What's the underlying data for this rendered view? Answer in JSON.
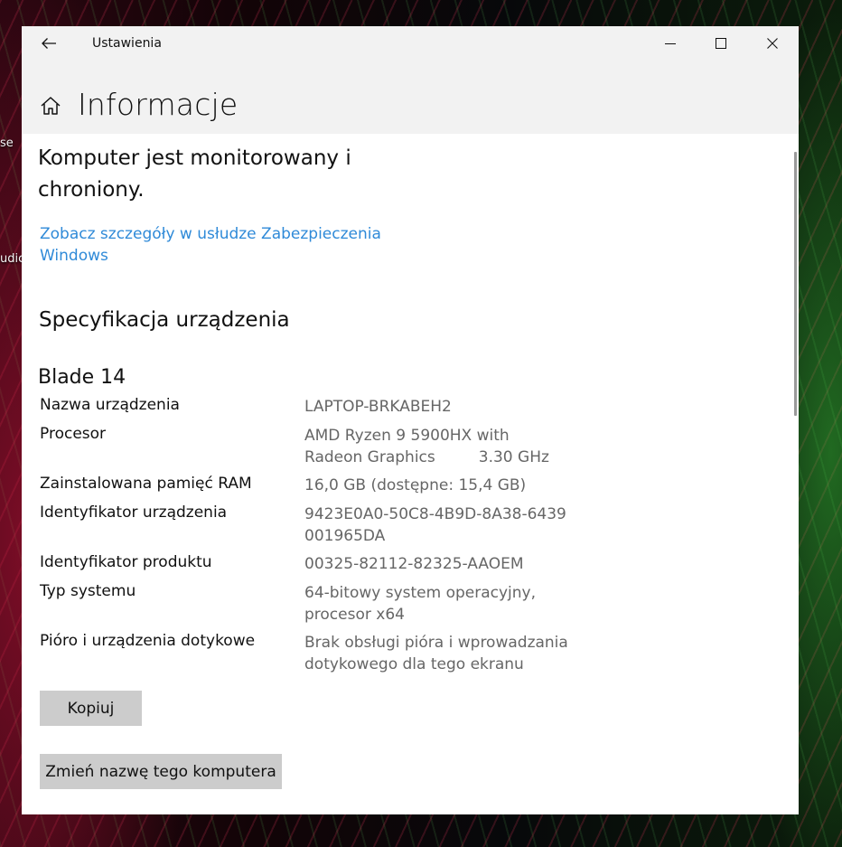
{
  "desktop": {
    "labels": [
      "se",
      "udic"
    ]
  },
  "window": {
    "app_title": "Ustawienia",
    "controls": [
      "minimize",
      "maximize",
      "close"
    ]
  },
  "header": {
    "title": "Informacje",
    "icon": "home-icon"
  },
  "security": {
    "status_line1": "Komputer jest monitorowany i",
    "status_line2": "chroniony.",
    "link_line1": "Zobacz szczegóły w usłudze Zabezpieczenia",
    "link_line2": "Windows"
  },
  "specs": {
    "section_title": "Specyfikacja urządzenia",
    "device_model": "Blade 14",
    "rows": [
      {
        "label": "Nazwa urządzenia",
        "value_lines": [
          "LAPTOP-BRKABEH2"
        ]
      },
      {
        "label": "Procesor",
        "value_lines": [
          "AMD Ryzen 9 5900HX with",
          "Radeon Graphics"
        ],
        "extra": "3.30 GHz"
      },
      {
        "label": "Zainstalowana pamięć RAM",
        "value_lines": [
          "16,0 GB (dostępne: 15,4 GB)"
        ]
      },
      {
        "label": "Identyfikator urządzenia",
        "value_lines": [
          "9423E0A0-50C8-4B9D-8A38-6439",
          "001965DA"
        ]
      },
      {
        "label": "Identyfikator produktu",
        "value_lines": [
          "00325-82112-82325-AAOEM"
        ]
      },
      {
        "label": "Typ systemu",
        "value_lines": [
          "64-bitowy system operacyjny,",
          "procesor x64"
        ]
      },
      {
        "label": "Pióro i urządzenia dotykowe",
        "value_lines": [
          "Brak obsługi pióra i wprowadzania",
          "dotykowego dla tego ekranu"
        ]
      }
    ]
  },
  "buttons": {
    "copy": "Kopiuj",
    "rename": "Zmień nazwę tego komputera"
  },
  "colors": {
    "link": "#2f8ad8",
    "button_bg": "#cccccc",
    "header_bg": "#f2f2f2"
  }
}
